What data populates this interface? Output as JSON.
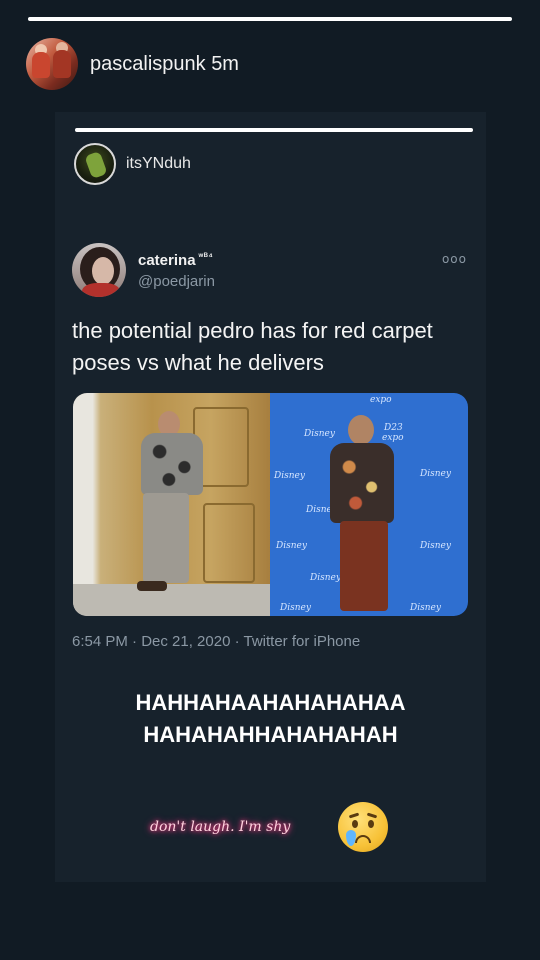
{
  "story": {
    "username": "pascalispunk",
    "time": "5m",
    "progress": 1.0
  },
  "repost": {
    "username": "itsYNduh",
    "progress": 1.0
  },
  "tweet": {
    "display_name": "caterina",
    "name_badge": "ʷᴮ⁴",
    "handle": "@poedjarin",
    "more_icon": "ooo",
    "text": "the potential pedro has for red carpet poses vs what he delivers",
    "meta": "6:54 PM · Dec 21, 2020 · Twitter for iPhone",
    "media": {
      "wall_text": [
        "Disney",
        "expo",
        "D23"
      ]
    }
  },
  "caption": {
    "line1": "HAHHAHAAHAHAHAHAA",
    "line2": "HAHAHAHHAHAHAHAH"
  },
  "sticker_text": "don't laugh. I'm shy",
  "emoji": "crying-face",
  "colors": {
    "background": "#111b24",
    "card": "#17222c",
    "muted": "#8b98a4",
    "sticker_glow": "#ff3b86"
  }
}
